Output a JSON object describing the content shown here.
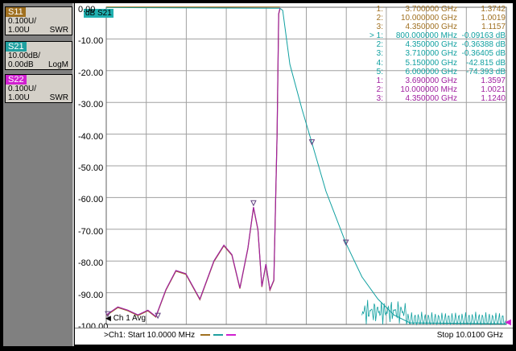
{
  "traces": [
    {
      "name": "S11",
      "scale": "0.100U/",
      "ref": "1.00U",
      "format": "SWR",
      "color": "#a07020"
    },
    {
      "name": "S21",
      "scale": "10.00dB/",
      "ref": "0.00dB",
      "format": "LogM",
      "color": "#20a0a0"
    },
    {
      "name": "S22",
      "scale": "0.100U/",
      "ref": "1.00U",
      "format": "SWR",
      "color": "#d020d0"
    }
  ],
  "active_trace_tag": "dB S21",
  "y_ticks": [
    "0.00",
    "-10.00",
    "-20.00",
    "-30.00",
    "-40.00",
    "-50.00",
    "-60.00",
    "-70.00",
    "-80.00",
    "-90.00",
    "-100.00"
  ],
  "markers": {
    "s11": [
      {
        "num": "1:",
        "freq": "3.700000 GHz",
        "val": "1.3742"
      },
      {
        "num": "2:",
        "freq": "10.000000 GHz",
        "val": "1.0019"
      },
      {
        "num": "3:",
        "freq": "4.350000 GHz",
        "val": "1.1157"
      }
    ],
    "s21": [
      {
        "num": "> 1:",
        "freq": "800.000000 MHz",
        "val": "-0.09163 dB"
      },
      {
        "num": "2:",
        "freq": "4.350000 GHz",
        "val": "-0.36388 dB"
      },
      {
        "num": "3:",
        "freq": "3.710000 GHz",
        "val": "-0.36405 dB"
      },
      {
        "num": "4:",
        "freq": "5.150000 GHz",
        "val": "-42.815 dB"
      },
      {
        "num": "5:",
        "freq": "6.000000 GHz",
        "val": "-74.393 dB"
      }
    ],
    "s22": [
      {
        "num": "1:",
        "freq": "3.690000 GHz",
        "val": "1.3597"
      },
      {
        "num": "2:",
        "freq": "10.000000 MHz",
        "val": "1.0021"
      },
      {
        "num": "3:",
        "freq": "4.350000 GHz",
        "val": "1.1240"
      }
    ]
  },
  "channel": {
    "avg_label": "Ch 1 Avg",
    "start_label": ">Ch1: Start  10.0000 MHz",
    "stop_label": "Stop  10.0100 GHz"
  },
  "colors": {
    "s11": "#a07020",
    "s21": "#10a0a0",
    "s22": "#a020a0"
  }
}
